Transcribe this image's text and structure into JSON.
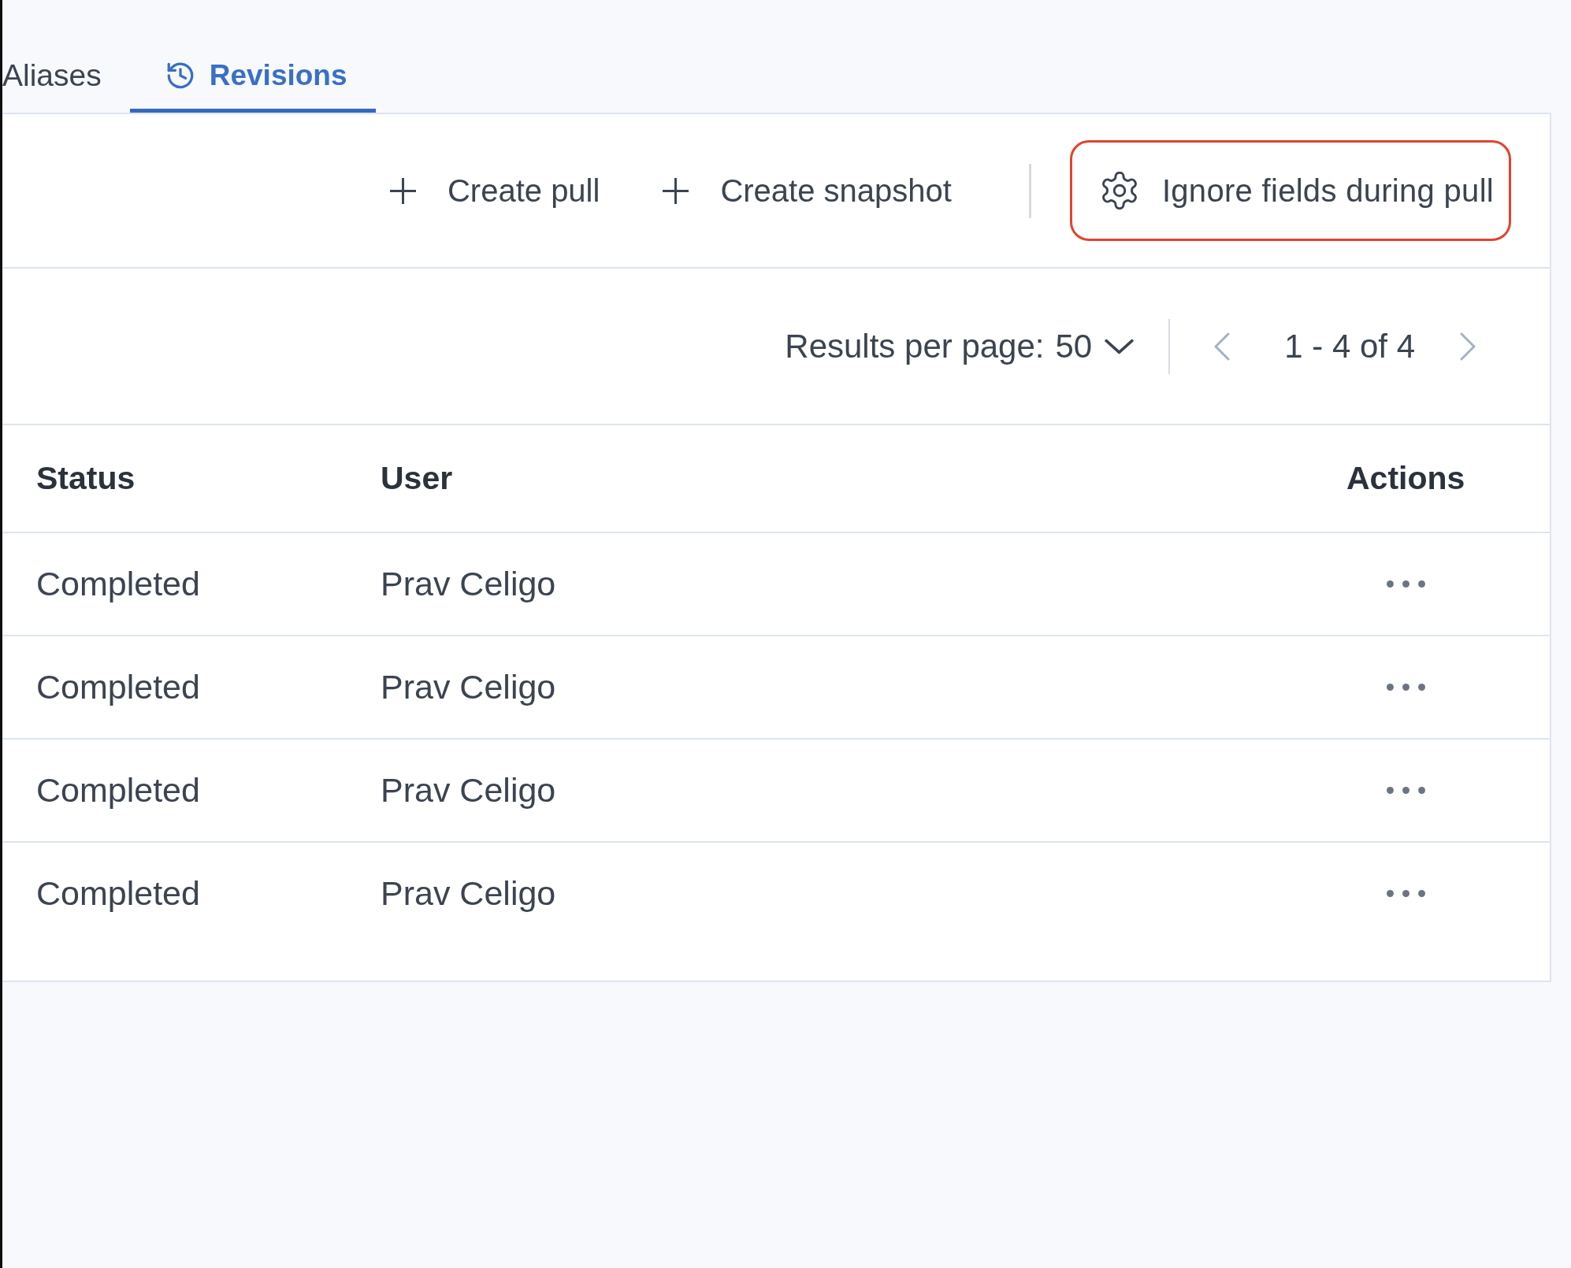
{
  "tabs": [
    {
      "label": "Aliases",
      "kind": "plain",
      "selected": false
    },
    {
      "label": "Revisions",
      "kind": "with_icon",
      "selected": true
    }
  ],
  "toolbar": {
    "actions": [
      {
        "label": "Create pull"
      },
      {
        "label": "Create snapshot"
      }
    ],
    "settings_action": {
      "label": "Ignore fields during pull",
      "highlighted": true
    }
  },
  "pagination": {
    "label": "Results per page:",
    "page_size": "50",
    "range": "1 - 4 of 4",
    "previous": {
      "disabled": true
    },
    "next": {
      "disabled": true
    }
  },
  "table": {
    "columns": [
      {
        "label": "Status"
      },
      {
        "label": "User"
      },
      {
        "label": "Actions"
      }
    ],
    "rows": [
      {
        "status": "Completed",
        "user": "Prav Celigo"
      },
      {
        "status": "Completed",
        "user": "Prav Celigo"
      },
      {
        "status": "Completed",
        "user": "Prav Celigo"
      },
      {
        "status": "Completed",
        "user": "Prav Celigo"
      }
    ]
  }
}
